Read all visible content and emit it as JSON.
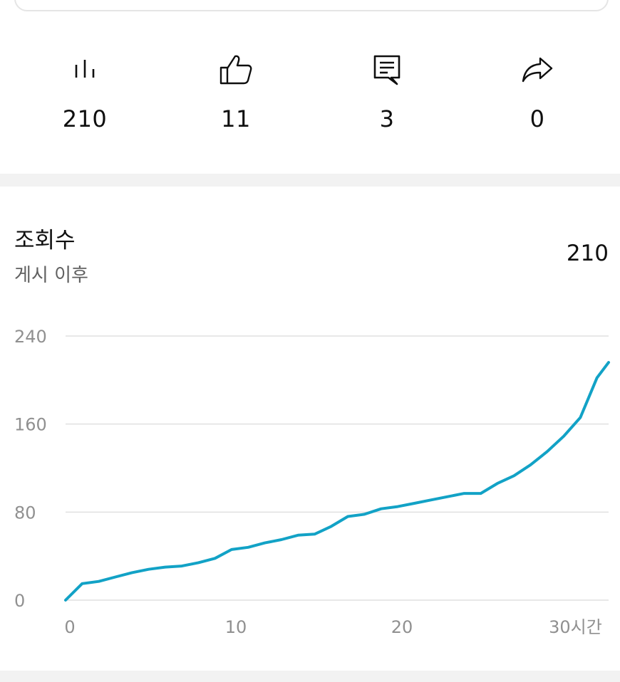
{
  "stats": [
    {
      "icon": "views-bars-icon",
      "value": "210"
    },
    {
      "icon": "thumbs-up-icon",
      "value": "11"
    },
    {
      "icon": "comment-icon",
      "value": "3"
    },
    {
      "icon": "share-icon",
      "value": "0"
    }
  ],
  "metric": {
    "title": "조회수",
    "subtitle": "게시 이후",
    "total": "210"
  },
  "colors": {
    "line": "#12a2c6",
    "grid": "#e0e0e0",
    "tick": "#909090"
  },
  "chart_data": {
    "type": "line",
    "title": "",
    "xlabel": "",
    "ylabel": "",
    "ylim": [
      0,
      240
    ],
    "xlim": [
      0,
      32.7
    ],
    "y_ticks": [
      "240",
      "160",
      "80",
      "0"
    ],
    "y_tick_values": [
      240,
      160,
      80,
      0
    ],
    "x_ticks": [
      "0",
      "10",
      "20",
      "30시간"
    ],
    "x_tick_values": [
      0,
      10,
      20,
      30
    ],
    "grid": true,
    "series": [
      {
        "values": [
          [
            0,
            0
          ],
          [
            1,
            15
          ],
          [
            2,
            17
          ],
          [
            3,
            21
          ],
          [
            4,
            25
          ],
          [
            5,
            28
          ],
          [
            6,
            30
          ],
          [
            7,
            31
          ],
          [
            8,
            34
          ],
          [
            9,
            38
          ],
          [
            10,
            46
          ],
          [
            11,
            48
          ],
          [
            12,
            52
          ],
          [
            13,
            55
          ],
          [
            14,
            59
          ],
          [
            15,
            60
          ],
          [
            16,
            67
          ],
          [
            17,
            76
          ],
          [
            18,
            78
          ],
          [
            19,
            83
          ],
          [
            20,
            85
          ],
          [
            21,
            88
          ],
          [
            22,
            91
          ],
          [
            23,
            94
          ],
          [
            24,
            97
          ],
          [
            25,
            97
          ],
          [
            26,
            106
          ],
          [
            27,
            113
          ],
          [
            28,
            123
          ],
          [
            29,
            135
          ],
          [
            30,
            149
          ],
          [
            31,
            166
          ],
          [
            32,
            202
          ],
          [
            32.7,
            216
          ]
        ]
      }
    ]
  }
}
